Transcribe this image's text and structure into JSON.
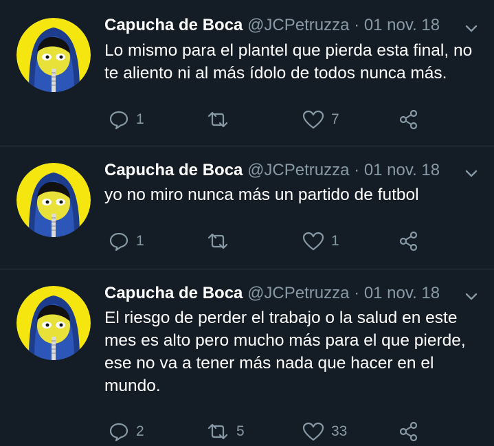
{
  "colors": {
    "background": "#141d26",
    "text": "#ffffff",
    "muted": "#8899a6",
    "divider": "#2f3a45"
  },
  "tweets": [
    {
      "name": "Capucha de Boca",
      "handle": "@JCPetruzza",
      "date": "01 nov. 18",
      "text": "Lo mismo para el plantel que pierda esta final, no te aliento ni al más ídolo de todos nunca más.",
      "replies": "1",
      "retweets": "",
      "likes": "7"
    },
    {
      "name": "Capucha de Boca",
      "handle": "@JCPetruzza",
      "date": "01 nov. 18",
      "text": "yo no miro nunca más un partido de futbol",
      "replies": "1",
      "retweets": "",
      "likes": "1"
    },
    {
      "name": "Capucha de Boca",
      "handle": "@JCPetruzza",
      "date": "01 nov. 18",
      "text": "El riesgo de perder el trabajo o la salud en este mes es alto pero mucho más para el que pierde, ese no va a tener más nada que hacer en el mundo.",
      "replies": "2",
      "retweets": "5",
      "likes": "33"
    }
  ],
  "icons": {
    "reply": "reply-icon",
    "retweet": "retweet-icon",
    "like": "heart-icon",
    "share": "share-icon",
    "more": "chevron-down-icon",
    "avatar": "hooded-cartoon-avatar"
  }
}
